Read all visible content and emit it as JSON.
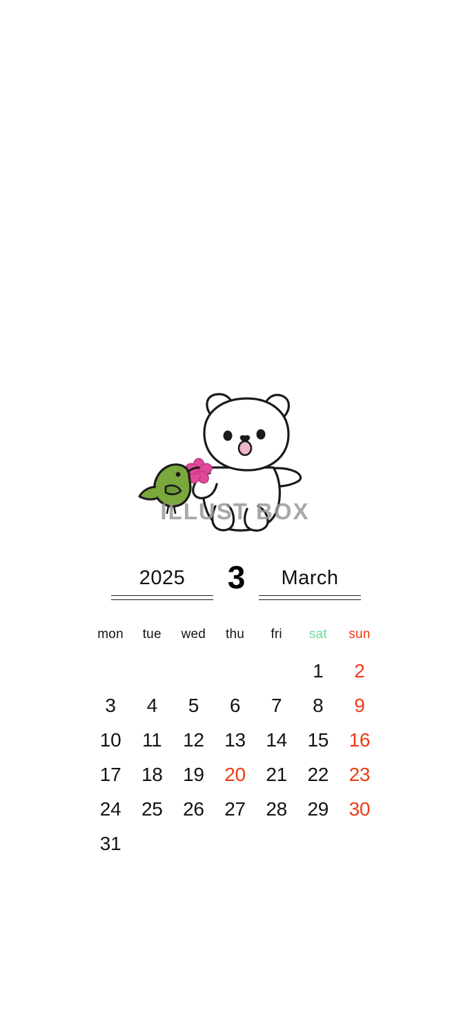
{
  "page": {
    "background_color": "#ffffff",
    "watermark": "ILLUST BOX"
  },
  "illustration": {
    "name": "bear-with-warbler-and-sakura",
    "items": [
      {
        "name": "bear-cub",
        "color": "#ffffff",
        "outline": "#1a1a1a"
      },
      {
        "name": "warbler-bird",
        "color": "#7aa83c",
        "outline": "#1a1a1a"
      },
      {
        "name": "sakura-flower",
        "color": "#e0499a",
        "outline": "#c03a80"
      }
    ]
  },
  "calendar": {
    "year": "2025",
    "month_number": "3",
    "month_name": "March",
    "week_start": "mon",
    "weekdays": [
      {
        "label": "mon",
        "kind": "weekday"
      },
      {
        "label": "tue",
        "kind": "weekday"
      },
      {
        "label": "wed",
        "kind": "weekday"
      },
      {
        "label": "thu",
        "kind": "weekday"
      },
      {
        "label": "fri",
        "kind": "weekday"
      },
      {
        "label": "sat",
        "kind": "saturday",
        "color": "#66dd99"
      },
      {
        "label": "sun",
        "kind": "sunday",
        "color": "#ee3a14"
      }
    ],
    "colors": {
      "default_date": "#131313",
      "holiday_date": "#ee3a14",
      "saturday_label": "#66dd99",
      "sunday_label": "#ee3a14"
    },
    "weeks": [
      [
        {
          "label": "",
          "empty": true
        },
        {
          "label": "",
          "empty": true
        },
        {
          "label": "",
          "empty": true
        },
        {
          "label": "",
          "empty": true
        },
        {
          "label": "",
          "empty": true
        },
        {
          "label": "1",
          "red": false
        },
        {
          "label": "2",
          "red": true
        }
      ],
      [
        {
          "label": "3",
          "red": false
        },
        {
          "label": "4",
          "red": false
        },
        {
          "label": "5",
          "red": false
        },
        {
          "label": "6",
          "red": false
        },
        {
          "label": "7",
          "red": false
        },
        {
          "label": "8",
          "red": false
        },
        {
          "label": "9",
          "red": true
        }
      ],
      [
        {
          "label": "10",
          "red": false
        },
        {
          "label": "11",
          "red": false
        },
        {
          "label": "12",
          "red": false
        },
        {
          "label": "13",
          "red": false
        },
        {
          "label": "14",
          "red": false
        },
        {
          "label": "15",
          "red": false
        },
        {
          "label": "16",
          "red": true
        }
      ],
      [
        {
          "label": "17",
          "red": false
        },
        {
          "label": "18",
          "red": false
        },
        {
          "label": "19",
          "red": false
        },
        {
          "label": "20",
          "red": true
        },
        {
          "label": "21",
          "red": false
        },
        {
          "label": "22",
          "red": false
        },
        {
          "label": "23",
          "red": true
        }
      ],
      [
        {
          "label": "24",
          "red": false
        },
        {
          "label": "25",
          "red": false
        },
        {
          "label": "26",
          "red": false
        },
        {
          "label": "27",
          "red": false
        },
        {
          "label": "28",
          "red": false
        },
        {
          "label": "29",
          "red": false
        },
        {
          "label": "30",
          "red": true
        }
      ],
      [
        {
          "label": "31",
          "red": false
        },
        {
          "label": "",
          "empty": true
        },
        {
          "label": "",
          "empty": true
        },
        {
          "label": "",
          "empty": true
        },
        {
          "label": "",
          "empty": true
        },
        {
          "label": "",
          "empty": true
        },
        {
          "label": "",
          "empty": true
        }
      ]
    ]
  }
}
